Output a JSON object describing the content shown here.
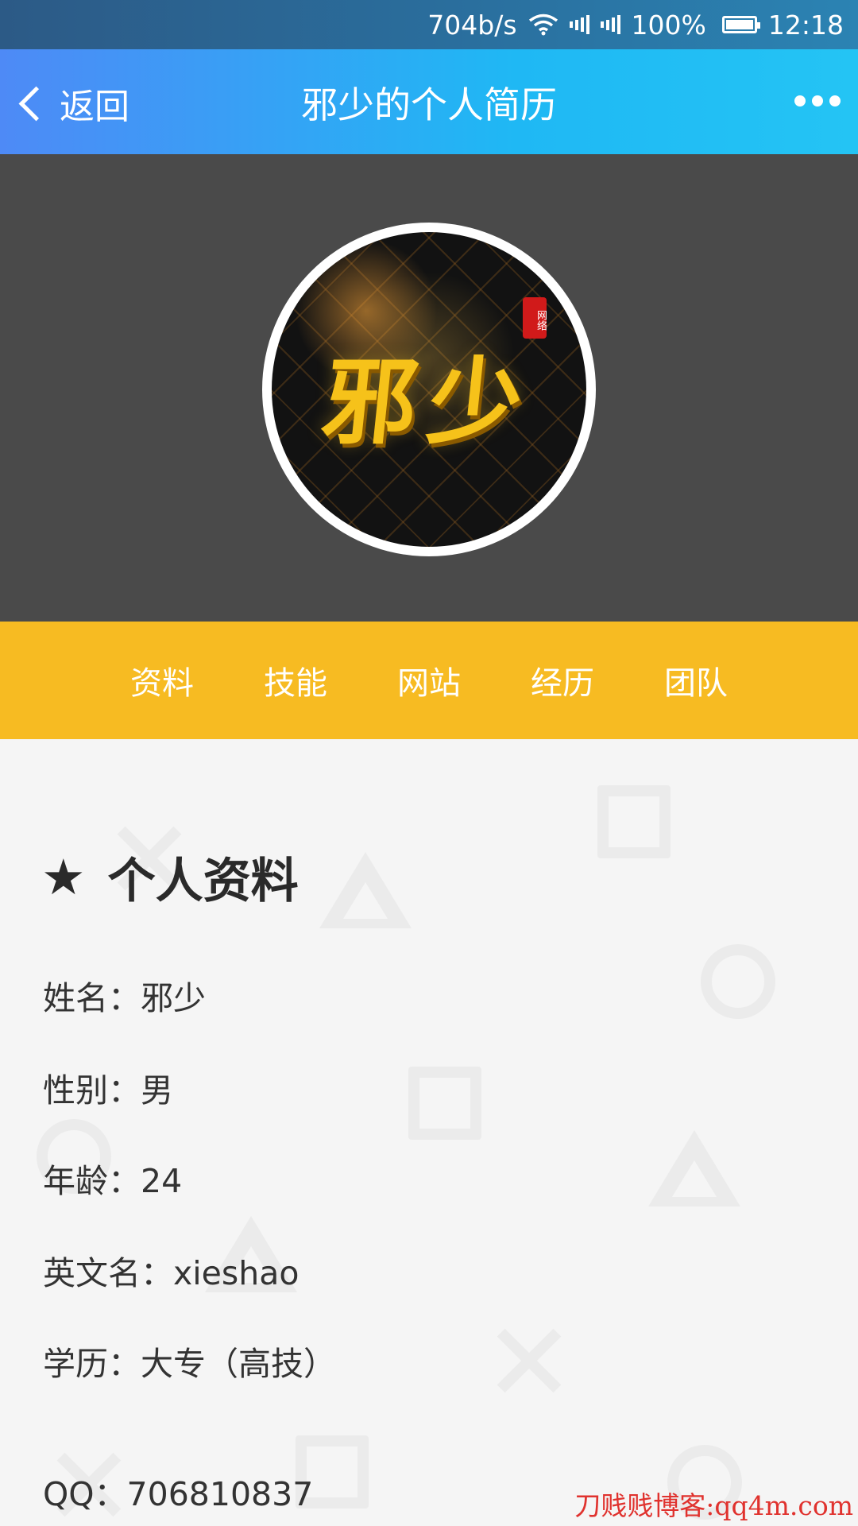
{
  "status_bar": {
    "speed": "704b/s",
    "battery": "100%",
    "time": "12:18"
  },
  "navbar": {
    "back_label": "返回",
    "title": "邪少的个人简历"
  },
  "avatar": {
    "text": "邪少",
    "seal": "网络"
  },
  "tabs": [
    "资料",
    "技能",
    "网站",
    "经历",
    "团队"
  ],
  "section": {
    "title": "个人资料"
  },
  "info": [
    "姓名：邪少",
    "性别：男",
    "年龄：24",
    "英文名：xieshao",
    "学历：大专（高技）",
    "QQ：706810837"
  ],
  "watermark": "刀贱贱博客:qq4m.com",
  "colors": {
    "status_bar": "#2a6f9e",
    "navbar_start": "#4e8af6",
    "navbar_end": "#24c4f4",
    "hero_bg": "#4a4a4a",
    "tabs_bg": "#f7bb22",
    "content_bg": "#f5f5f5"
  }
}
